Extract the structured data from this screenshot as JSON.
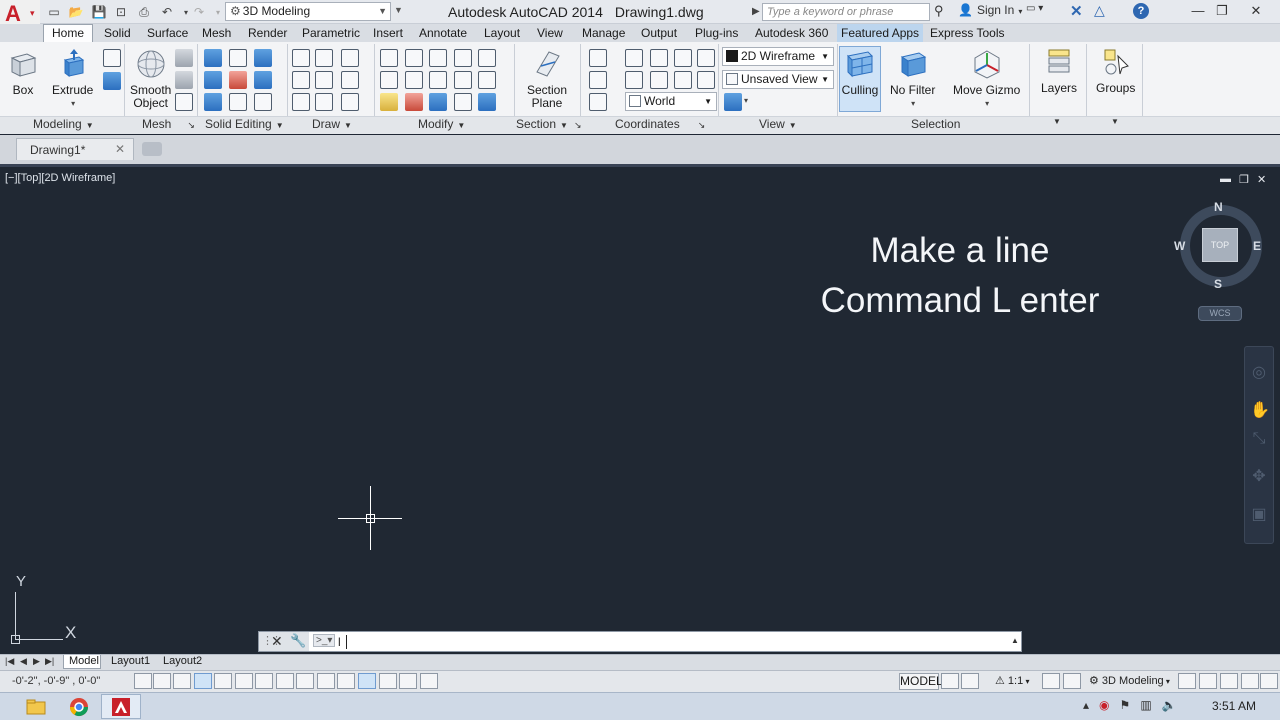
{
  "titlebar": {
    "logo_letter": "A",
    "workspace": "3D Modeling",
    "app_name": "Autodesk AutoCAD 2014",
    "document": "Drawing1.dwg",
    "search_placeholder": "Type a keyword or phrase",
    "sign_in": "Sign In"
  },
  "ribbon_tabs": [
    "Home",
    "Solid",
    "Surface",
    "Mesh",
    "Render",
    "Parametric",
    "Insert",
    "Annotate",
    "Layout",
    "View",
    "Manage",
    "Output",
    "Plug-ins",
    "Autodesk 360",
    "Featured Apps",
    "Express Tools"
  ],
  "ribbon": {
    "box": "Box",
    "extrude": "Extrude",
    "smooth_object_1": "Smooth",
    "smooth_object_2": "Object",
    "section_plane_1": "Section",
    "section_plane_2": "Plane",
    "visual_style": "2D Wireframe",
    "saved_view": "Unsaved View",
    "ucs": "World",
    "culling": "Culling",
    "no_filter": "No Filter",
    "move_gizmo": "Move Gizmo",
    "layers": "Layers",
    "groups": "Groups",
    "panels": {
      "modeling": "Modeling",
      "mesh": "Mesh",
      "solid_editing": "Solid Editing",
      "draw": "Draw",
      "modify": "Modify",
      "section": "Section",
      "coordinates": "Coordinates",
      "view": "View",
      "selection": "Selection"
    }
  },
  "file_tab": "Drawing1*",
  "viewport_label": "[−][Top][2D Wireframe]",
  "overlay": {
    "line1": "Make a line",
    "line2": "Command L enter"
  },
  "viewcube": {
    "top": "TOP",
    "n": "N",
    "s": "S",
    "e": "E",
    "w": "W",
    "wcs": "WCS"
  },
  "ucs_icon": {
    "x": "X",
    "y": "Y"
  },
  "command_line": {
    "input": "l"
  },
  "layout_tabs": [
    "Model",
    "Layout1",
    "Layout2"
  ],
  "statusbar": {
    "coords": "-0'-2\",  -0'-9\" , 0'-0\"",
    "model": "MODEL",
    "scale": "1:1",
    "workspace": "3D Modeling"
  },
  "taskbar": {
    "clock": "3:51 AM"
  },
  "colors": {
    "canvas": "#202833",
    "autocad_red": "#c8202a",
    "accent_blue": "#2e67b1"
  }
}
